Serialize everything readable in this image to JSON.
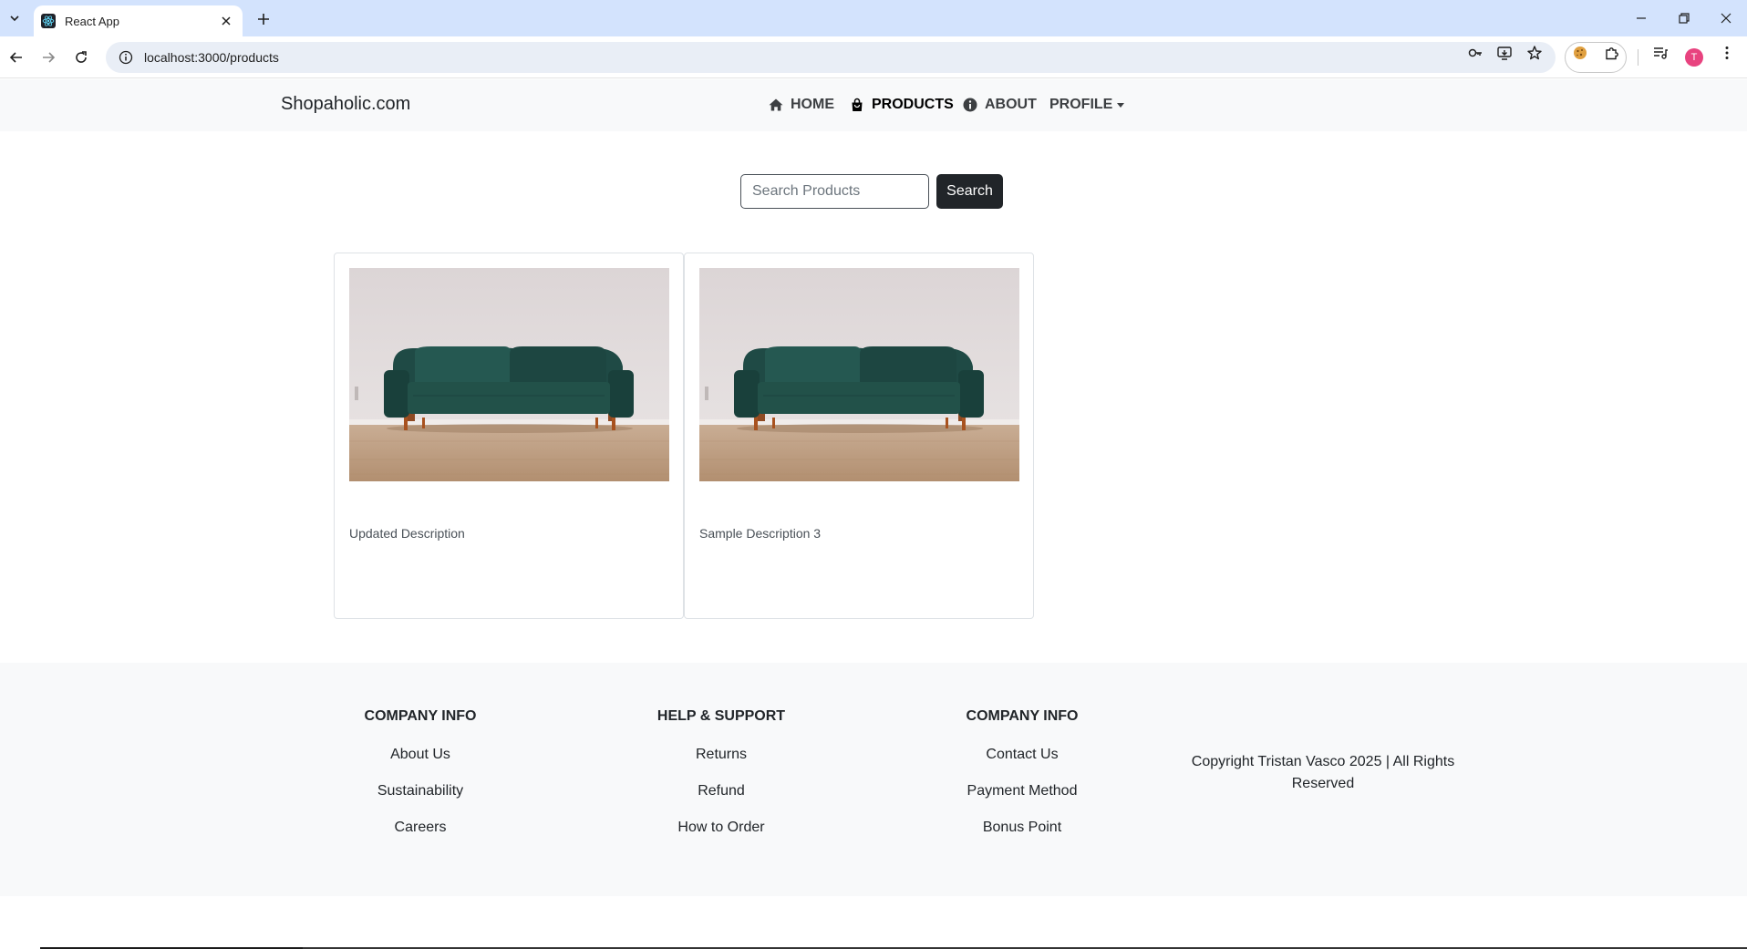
{
  "browser": {
    "tab_title": "React App",
    "url": "localhost:3000/products",
    "avatar_initial": "T"
  },
  "navbar": {
    "brand": "Shopaholic.com",
    "items": [
      {
        "label": "HOME",
        "icon": "home-icon"
      },
      {
        "label": "PRODUCTS",
        "icon": "shopping-bag-icon"
      },
      {
        "label": "ABOUT",
        "icon": "info-icon"
      },
      {
        "label": "PROFILE",
        "icon": "dropdown-caret"
      }
    ]
  },
  "search": {
    "placeholder": "Search Products",
    "button_label": "Search"
  },
  "products": [
    {
      "description": "Updated Description",
      "image": "green-velvet-sofa"
    },
    {
      "description": "Sample Description 3",
      "image": "green-velvet-sofa"
    }
  ],
  "footer": {
    "columns": [
      {
        "heading": "COMPANY INFO",
        "links": [
          "About Us",
          "Sustainability",
          "Careers"
        ]
      },
      {
        "heading": "HELP & SUPPORT",
        "links": [
          "Returns",
          "Refund",
          "How to Order"
        ]
      },
      {
        "heading": "COMPANY INFO",
        "links": [
          "Contact Us",
          "Payment Method",
          "Bonus Point"
        ]
      }
    ],
    "copyright": "Copyright Tristan Vasco 2025 | All Rights Reserved"
  },
  "colors": {
    "tabstrip": "#d3e3fd",
    "navbar_bg": "#f8f9fa",
    "button_dark": "#212529",
    "sofa_green": "#1f4a45"
  }
}
